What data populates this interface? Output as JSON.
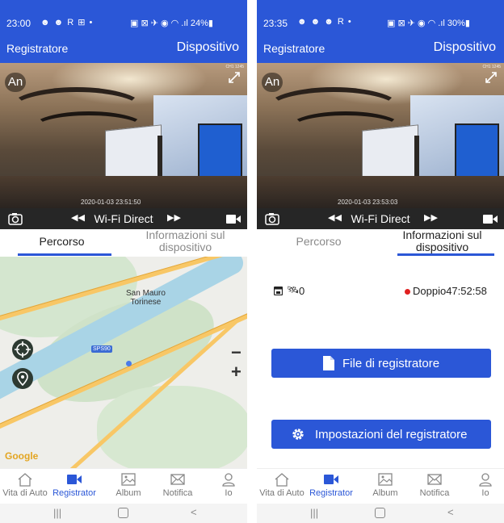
{
  "colors": {
    "primary": "#2b57d7",
    "record_dot": "#e02020",
    "map_water": "#a9d4e6",
    "map_road": "#f8c766"
  },
  "left": {
    "status": {
      "time": "23:00",
      "icons": "☻ ☻ R ⊞ •",
      "right": "▣ ⊠ ✈ ◉ ◠ .ıl 24%▮"
    },
    "appbar": {
      "title": "Registratore",
      "action": "Dispositivo"
    },
    "video": {
      "channel": "CH1 1245",
      "overlay_badge": "An",
      "timestamp": "2020-01-03 23:51:50"
    },
    "controls": {
      "rewind": "◀◀",
      "mode": "Wi-Fi Direct",
      "forward": "▶▶"
    },
    "tabs": [
      {
        "label": "Percorso"
      },
      {
        "label": "Informazioni sul dispositivo"
      }
    ],
    "active_tab": 0,
    "map": {
      "place_line1": "San Mauro",
      "place_line2": "Torinese",
      "road_shield": "SPS90",
      "zoom_out": "−",
      "zoom_in": "+",
      "attribution": "Google"
    },
    "nav": [
      {
        "label": "Vita di Auto",
        "icon": "home-icon"
      },
      {
        "label": "Registrator",
        "icon": "video-camera-icon"
      },
      {
        "label": "Album",
        "icon": "image-icon"
      },
      {
        "label": "Notifica",
        "icon": "mail-icon"
      },
      {
        "label": "Io",
        "icon": "person-icon"
      }
    ],
    "active_nav": 1,
    "sysnav": {
      "recent": "|||",
      "back": "<"
    }
  },
  "right": {
    "status": {
      "time": "23:35",
      "icons": "☻ ☻ ☻ R •",
      "right": "▣ ⊠ ✈ ◉ ◠ .ıl 30%▮"
    },
    "appbar": {
      "title": "Registratore",
      "action": "Dispositivo"
    },
    "video": {
      "channel": "CH1 1245",
      "overlay_badge": "An",
      "timestamp": "2020-01-03 23:53:03"
    },
    "controls": {
      "rewind": "◀◀",
      "mode": "Wi-Fi Direct",
      "forward": "▶▶"
    },
    "tabs": [
      {
        "label": "Percorso"
      },
      {
        "label": "Informazioni sul dispositivo"
      }
    ],
    "active_tab": 1,
    "info": {
      "satellites": "0",
      "record_status": "Doppio47:52:58",
      "files_button": "File di registratore",
      "settings_button": "Impostazioni del registratore"
    },
    "nav": [
      {
        "label": "Vita di Auto",
        "icon": "home-icon"
      },
      {
        "label": "Registrator",
        "icon": "video-camera-icon"
      },
      {
        "label": "Album",
        "icon": "image-icon"
      },
      {
        "label": "Notifica",
        "icon": "mail-icon"
      },
      {
        "label": "Io",
        "icon": "person-icon"
      }
    ],
    "active_nav": 1,
    "sysnav": {
      "recent": "|||",
      "back": "<"
    }
  }
}
